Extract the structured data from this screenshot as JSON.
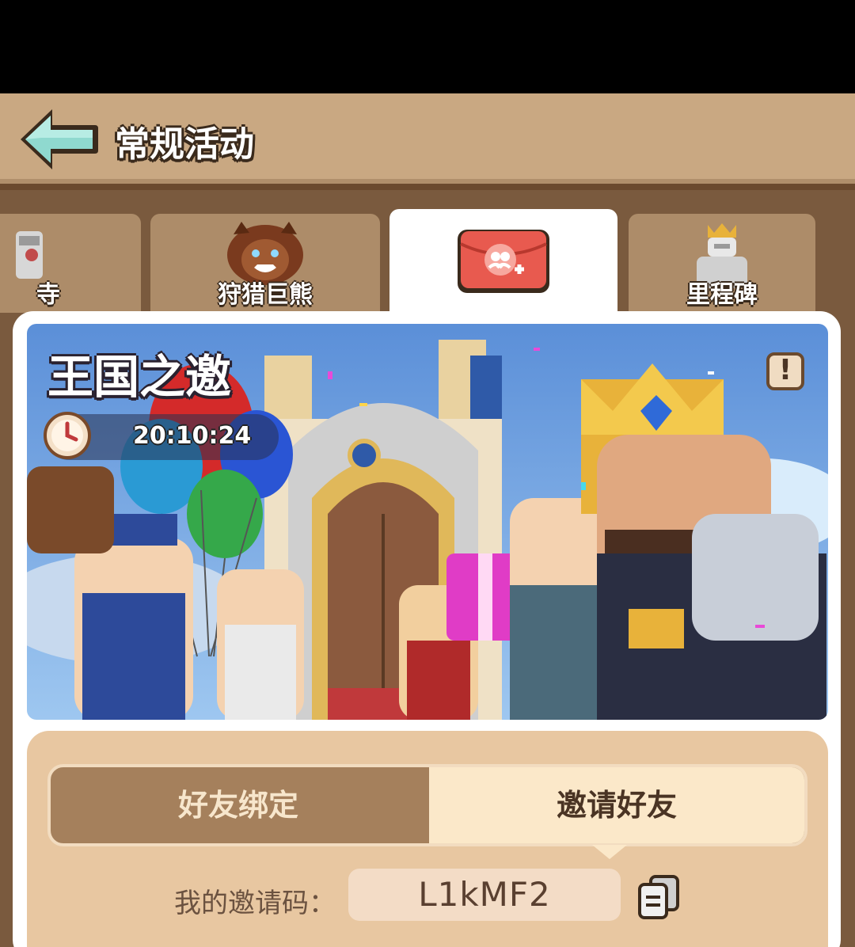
{
  "header": {
    "title": "常规活动",
    "back_icon": "arrow-left-icon"
  },
  "tabs": [
    {
      "label": "寺",
      "icon": "stone-statue-icon",
      "active": false
    },
    {
      "label": "狩猎巨熊",
      "icon": "bear-icon",
      "active": false
    },
    {
      "label": "",
      "icon": "invite-envelope-icon",
      "active": true
    },
    {
      "label": "里程碑",
      "icon": "king-statue-icon",
      "active": false
    }
  ],
  "banner": {
    "title": "王国之邀",
    "timer": "20:10:24",
    "info_label": "!"
  },
  "segment": {
    "left_label": "好友绑定",
    "right_label": "邀请好友"
  },
  "invite": {
    "code_label": "我的邀请码：",
    "code": "L1kMF2",
    "copy_icon": "copy-icon"
  },
  "colors": {
    "header_bg": "#c9a882",
    "screen_bg": "#7a5a3e",
    "tab_bg": "#ad8c69",
    "accent_red": "#e85a4f",
    "segment_dark": "#a5805c",
    "segment_light": "#fbe8c9"
  }
}
